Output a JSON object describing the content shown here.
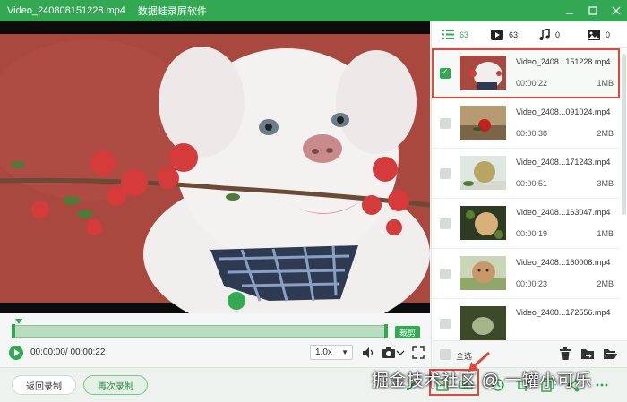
{
  "window": {
    "title": "Video_240808151228.mp4",
    "app_name": "数据蛙录屏软件"
  },
  "player": {
    "time_display": "00:00:00/ 00:00:22",
    "speed": "1.0x",
    "cut_label": "裁剪"
  },
  "bottom": {
    "back_label": "返回录制",
    "again_label": "再次录制"
  },
  "sidebar": {
    "tabs": [
      {
        "icon": "list-icon",
        "count": "63"
      },
      {
        "icon": "video-icon",
        "count": "63"
      },
      {
        "icon": "music-icon",
        "count": "0"
      },
      {
        "icon": "image-icon",
        "count": "0"
      }
    ],
    "items": [
      {
        "name": "Video_2408...151228.mp4",
        "duration": "00:00:22",
        "size": "1MB",
        "selected": true
      },
      {
        "name": "Video_2408...091024.mp4",
        "duration": "00:00:38",
        "size": "2MB",
        "selected": false
      },
      {
        "name": "Video_2408...171243.mp4",
        "duration": "00:00:51",
        "size": "3MB",
        "selected": false
      },
      {
        "name": "Video_2408...163047.mp4",
        "duration": "00:00:19",
        "size": "1MB",
        "selected": false
      },
      {
        "name": "Video_2408...160008.mp4",
        "duration": "00:00:23",
        "size": "2MB",
        "selected": false
      },
      {
        "name": "Video_2408...172556.mp4",
        "duration": "",
        "size": "",
        "selected": false
      }
    ],
    "select_all": "全选"
  },
  "watermark": "掘金技术社区 @ 一罐小可乐",
  "colors": {
    "accent": "#32a852",
    "highlight": "#e0493a"
  }
}
